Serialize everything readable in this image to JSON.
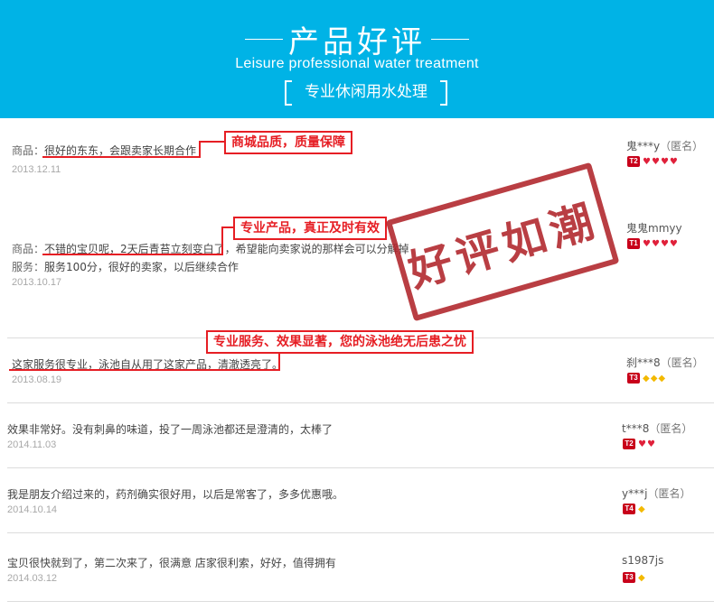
{
  "header": {
    "title": "产品好评",
    "subtitle": "Leisure professional water treatment",
    "tagline": "专业休闲用水处理"
  },
  "stamp": {
    "text": "好评如潮"
  },
  "callouts": {
    "c1": "商城品质，质量保障",
    "c2": "专业产品，真正及时有效",
    "c3": "专业服务、效果显著，您的泳池绝无后患之忧"
  },
  "reviews": [
    {
      "product_label": "商品：",
      "product_text": "很好的东东，会跟卖家长期合作",
      "date": "2013.12.11",
      "user": "鬼***y",
      "anon": "（匿名）",
      "level": "T2",
      "gems": [
        "heart",
        "heart",
        "heart",
        "heart"
      ]
    },
    {
      "product_label": "商品：",
      "product_text": "不错的宝贝呢，2天后青苔立刻变白了，希望能向卖家说的那样会可以分解掉",
      "service_label": "服务：",
      "service_text": "服务100分，很好的卖家，以后继续合作",
      "date": "2013.10.17",
      "user": "鬼鬼mmyy",
      "level": "T1",
      "gems": [
        "heart",
        "heart",
        "heart",
        "heart"
      ]
    },
    {
      "text": "这家服务很专业，泳池自从用了这家产品，清澈透亮了。",
      "date": "2013.08.19",
      "user": "刹***8",
      "anon": "（匿名）",
      "level": "T3",
      "gems": [
        "diamond",
        "diamond",
        "diamond"
      ]
    },
    {
      "text": "效果非常好。没有刺鼻的味道，投了一周泳池都还是澄清的，太棒了",
      "date": "2014.11.03",
      "user": "t***8",
      "anon": "（匿名）",
      "level": "T2",
      "gems": [
        "heart",
        "heart"
      ]
    },
    {
      "text": "我是朋友介绍过来的，药剂确实很好用，以后是常客了，多多优惠哦。",
      "date": "2014.10.14",
      "user": "y***j",
      "anon": "（匿名）",
      "level": "T4",
      "gems": [
        "diamond"
      ]
    },
    {
      "text": "宝贝很快就到了，第二次来了，很满意 店家很利索，好好，值得拥有",
      "date": "2014.03.12",
      "user": "s1987js",
      "level": "T3",
      "gems": [
        "diamond"
      ]
    }
  ],
  "colors": {
    "header_bg": "#00b3e6",
    "accent_red": "#e61e24",
    "stamp_red": "#b0242a",
    "date_gray": "#a8a8a8"
  }
}
